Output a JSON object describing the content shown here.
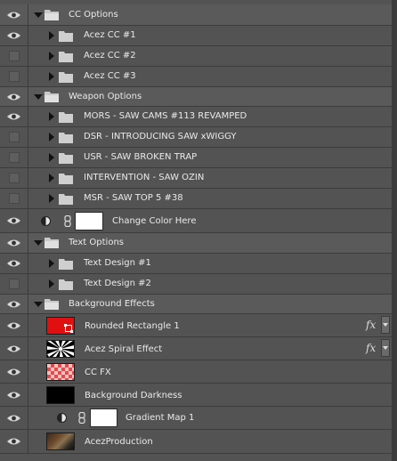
{
  "layers": [
    {
      "kind": "group",
      "label": "CC Options",
      "visible": true,
      "level": 0
    },
    {
      "kind": "folder",
      "label": "Acez CC #1",
      "visible": true,
      "level": 1
    },
    {
      "kind": "folder",
      "label": "Acez CC #2",
      "visible": false,
      "level": 1
    },
    {
      "kind": "folder",
      "label": "Acez CC #3",
      "visible": false,
      "level": 1
    },
    {
      "kind": "group",
      "label": "Weapon Options",
      "visible": true,
      "level": 0
    },
    {
      "kind": "folder",
      "label": "MORS - SAW CAMS #113 REVAMPED",
      "visible": true,
      "level": 1
    },
    {
      "kind": "folder",
      "label": "DSR - INTRODUCING SAW xWIGGY",
      "visible": false,
      "level": 1
    },
    {
      "kind": "folder",
      "label": "USR - SAW BROKEN TRAP",
      "visible": false,
      "level": 1
    },
    {
      "kind": "folder",
      "label": "INTERVENTION - SAW OZIN",
      "visible": false,
      "level": 1
    },
    {
      "kind": "folder",
      "label": "MSR - SAW TOP 5 #38",
      "visible": false,
      "level": 1
    },
    {
      "kind": "adjustment",
      "label": "Change Color Here",
      "visible": true,
      "level": 1
    },
    {
      "kind": "group",
      "label": "Text Options",
      "visible": true,
      "level": 0
    },
    {
      "kind": "folder",
      "label": "Text Design #1",
      "visible": true,
      "level": 1
    },
    {
      "kind": "folder",
      "label": "Text Design #2",
      "visible": false,
      "level": 1
    },
    {
      "kind": "group",
      "label": "Background Effects",
      "visible": true,
      "level": 0
    },
    {
      "kind": "layer",
      "label": "Rounded Rectangle 1",
      "visible": true,
      "thumb": "red-shape",
      "fx": "fx"
    },
    {
      "kind": "layer",
      "label": "Acez Spiral Effect",
      "visible": true,
      "thumb": "spiral",
      "fx": "fx"
    },
    {
      "kind": "layer",
      "label": "CC FX",
      "visible": true,
      "thumb": "checker-red"
    },
    {
      "kind": "layer",
      "label": "Background Darkness",
      "visible": true,
      "thumb": "black"
    },
    {
      "kind": "adjustment",
      "label": "Gradient Map 1",
      "visible": true,
      "level": 2
    },
    {
      "kind": "layer",
      "label": "AcezProduction",
      "visible": true,
      "thumb": "photo"
    }
  ],
  "colors": {
    "panel": "#535353",
    "accent_red": "#e01010"
  }
}
